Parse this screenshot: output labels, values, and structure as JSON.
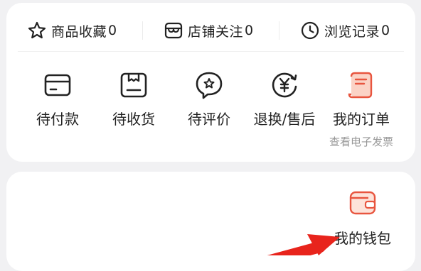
{
  "stats": [
    {
      "label": "商品收藏",
      "count": "0",
      "icon": "star-icon"
    },
    {
      "label": "店铺关注",
      "count": "0",
      "icon": "shop-icon"
    },
    {
      "label": "浏览记录",
      "count": "0",
      "icon": "clock-icon"
    }
  ],
  "orders": [
    {
      "label": "待付款",
      "icon": "wallet-card-icon"
    },
    {
      "label": "待收货",
      "icon": "package-icon"
    },
    {
      "label": "待评价",
      "icon": "review-star-icon"
    },
    {
      "label": "退换/售后",
      "icon": "refund-yen-icon"
    },
    {
      "label": "我的订单",
      "sub": "查看电子发票",
      "icon": "order-list-icon"
    }
  ],
  "wallet": {
    "label": "我的钱包",
    "icon": "purse-icon"
  },
  "colors": {
    "accent": "#e8553f",
    "accent_light": "#f7b09a",
    "arrow": "#e8241c",
    "background": "#f1f1f3",
    "card": "#ffffff"
  }
}
